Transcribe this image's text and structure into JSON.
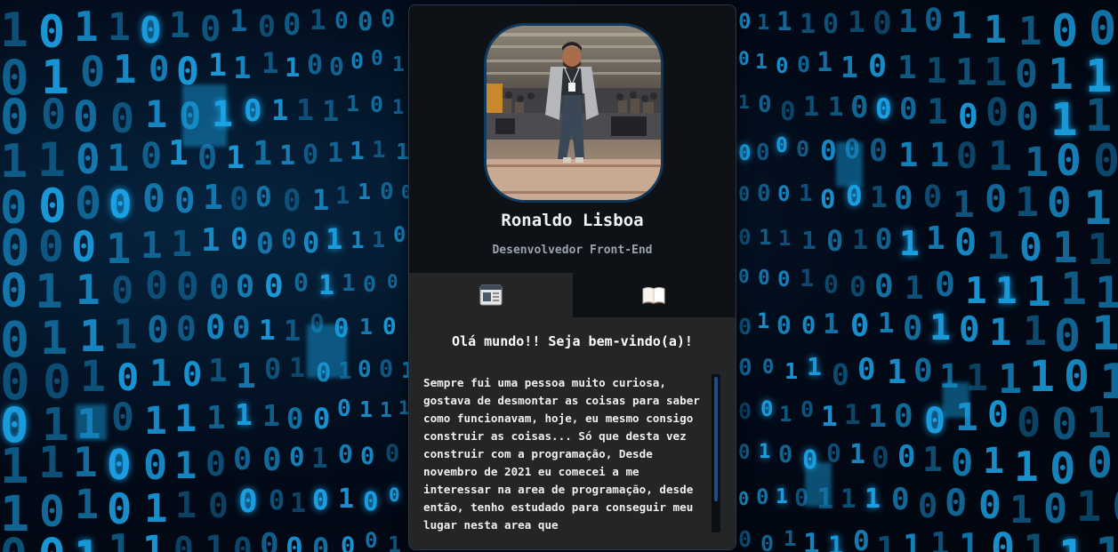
{
  "profile": {
    "name": "Ronaldo Lisboa",
    "role": "Desenvolvedor Front-End"
  },
  "tabs": [
    {
      "icon": "browser-window-icon",
      "active": true
    },
    {
      "icon": "open-book-icon",
      "active": false
    }
  ],
  "about": {
    "greeting": "Olá mundo!! Seja bem-vindo(a)!",
    "text": "Sempre fui uma pessoa muito curiosa, gostava de desmontar as coisas para saber como funcionavam, hoje, eu mesmo consigo construir as coisas... Só que desta vez construir com a programação, Desde novembro de 2021 eu comecei a me interessar na area de programação, desde então, tenho estudado para conseguir meu lugar nesta area que"
  },
  "colors": {
    "background": "#020814",
    "digits": "#1ca8ee",
    "card": "#0e1217",
    "content_panel": "#242526",
    "accent_border": "#0e3a5f",
    "scroll_thumb": "#1b4f86"
  }
}
